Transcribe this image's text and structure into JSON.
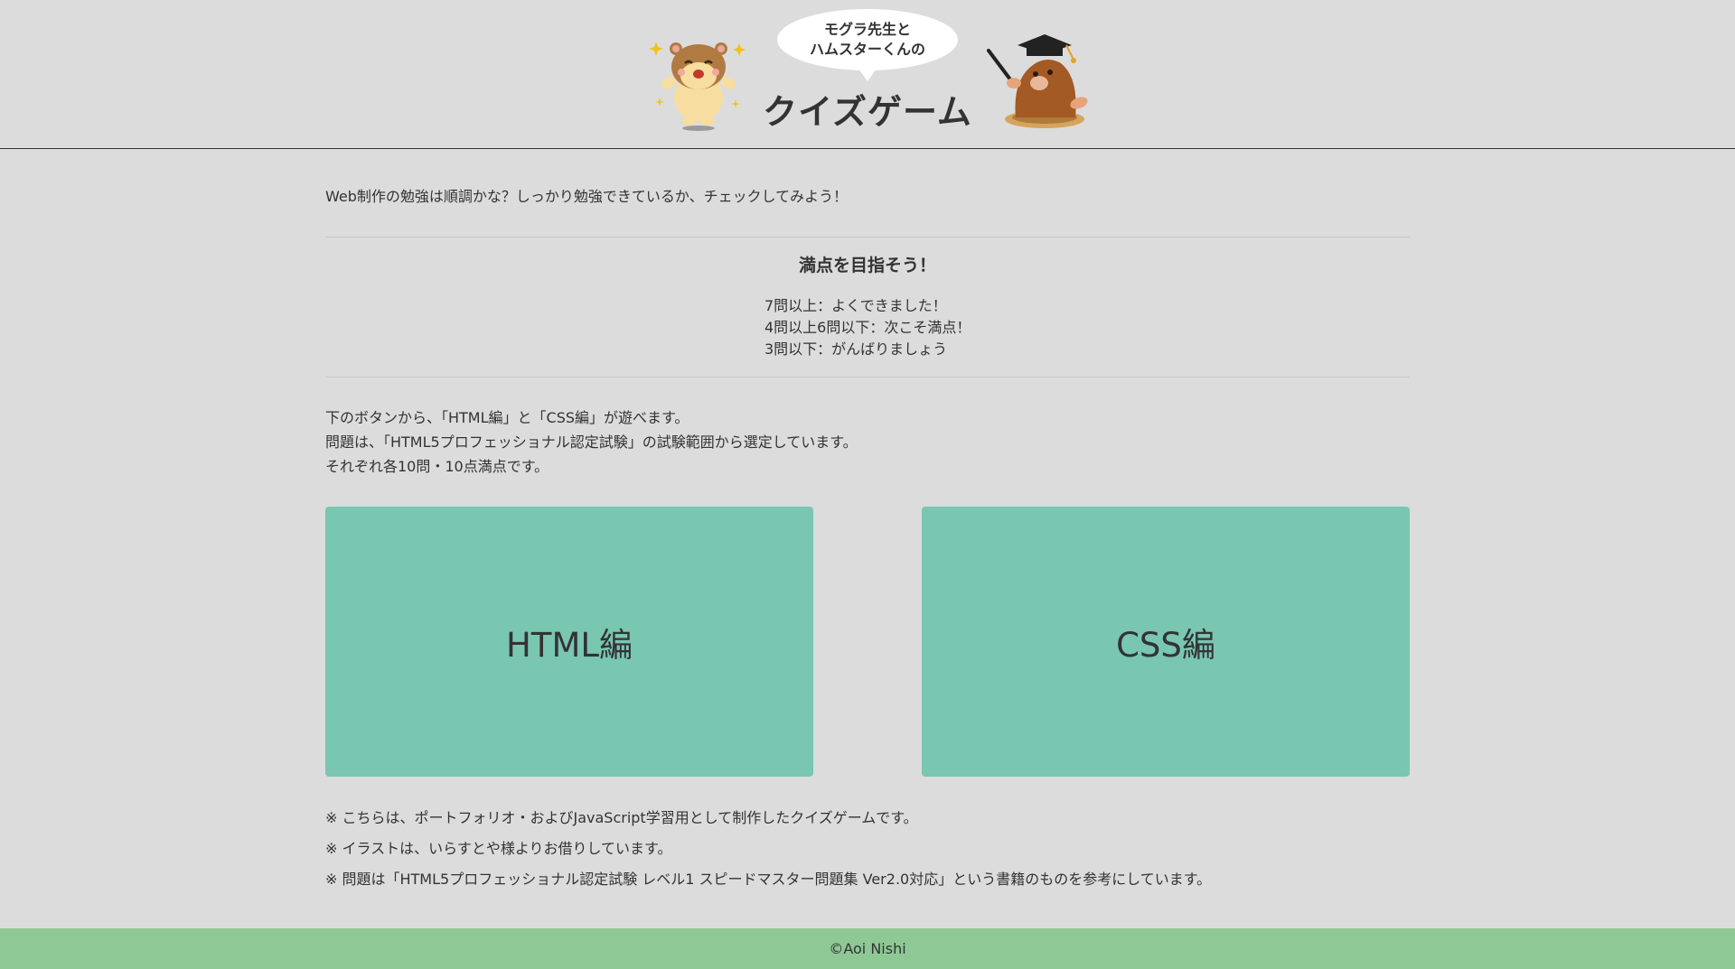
{
  "header": {
    "bubble_line1": "モグラ先生と",
    "bubble_line2": "ハムスターくんの",
    "title": "クイズゲーム"
  },
  "main": {
    "intro": "Web制作の勉強は順調かな？しっかり勉強できているか、チェックしてみよう！",
    "goal": {
      "heading": "満点を目指そう！",
      "tiers": [
        "7問以上：よくできました！",
        "4問以上6問以下：次こそ満点！",
        "3問以下：がんばりましょう"
      ]
    },
    "description": [
      "下のボタンから、「HTML編」と「CSS編」が遊べます。",
      "問題は、「HTML5プロフェッショナル認定試験」の試験範囲から選定しています。",
      "それぞれ各10問・10点満点です。"
    ],
    "buttons": {
      "html_label": "HTML編",
      "css_label": "CSS編"
    },
    "notes": [
      "※ こちらは、ポートフォリオ・およびJavaScript学習用として制作したクイズゲームです。",
      "※ イラストは、いらすとや様よりお借りしています。",
      "※ 問題は「HTML5プロフェッショナル認定試験 レベル1 スピードマスター問題集 Ver2.0対応」という書籍のものを参考にしています。"
    ]
  },
  "footer": {
    "copyright": "©Aoi Nishi"
  },
  "colors": {
    "background": "#dcdcdc",
    "button": "#79c6b1",
    "footer": "#8ec995",
    "text": "#333333"
  },
  "icons": {
    "left_illustration": "hamster-icon",
    "right_illustration": "mole-teacher-icon"
  }
}
